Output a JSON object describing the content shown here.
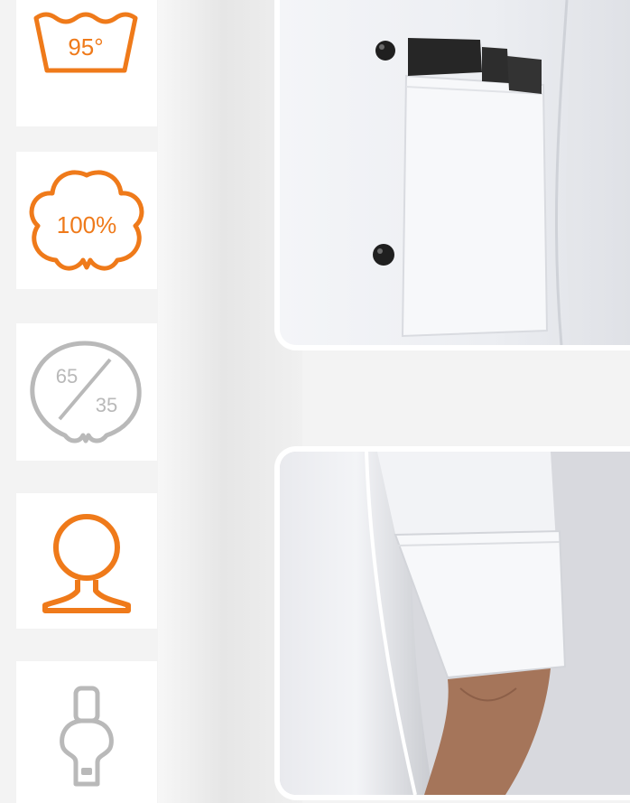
{
  "icons": [
    {
      "name": "wash-95-icon",
      "label": "95°",
      "color": "#ef7a1a"
    },
    {
      "name": "cotton-100-icon",
      "label": "100%",
      "color": "#ef7a1a"
    },
    {
      "name": "blend-65-35-icon",
      "top": "65",
      "bottom": "35",
      "color": "#b9b9b9"
    },
    {
      "name": "fit-person-icon",
      "color": "#ef7a1a"
    },
    {
      "name": "zipper-icon",
      "color": "#b9b9b9"
    }
  ],
  "photos": [
    {
      "name": "jacket-pocket-photo"
    },
    {
      "name": "jacket-cuff-photo"
    }
  ]
}
